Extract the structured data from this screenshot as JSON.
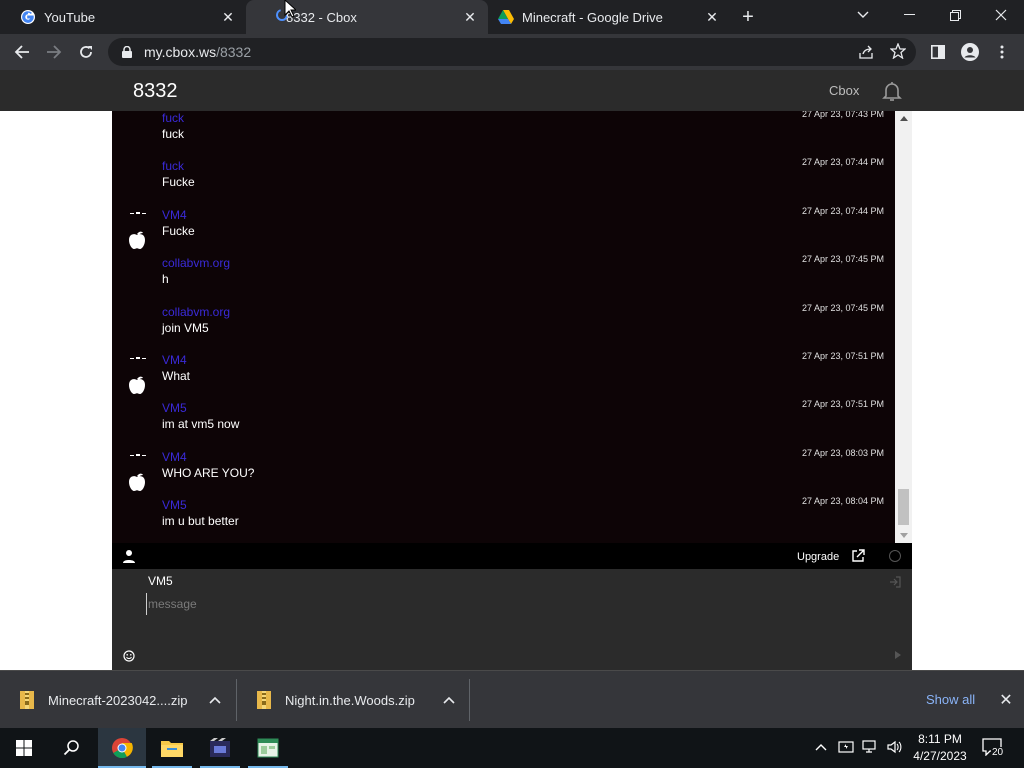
{
  "browser": {
    "tabs": [
      {
        "title": "YouTube",
        "icon": "google-icon",
        "active": false
      },
      {
        "title": "8332 - Cbox",
        "icon": "loading-spinner-icon",
        "active": true
      },
      {
        "title": "Minecraft - Google Drive",
        "icon": "google-drive-icon",
        "active": false
      }
    ],
    "url_host": "my.cbox.ws",
    "url_path": "/8332"
  },
  "site": {
    "box_name": "8332",
    "brand": "Cbox"
  },
  "messages": [
    {
      "name": "fuck",
      "text": "fuck",
      "time": "27 Apr 23, 07:43 PM",
      "avatar": false
    },
    {
      "name": "fuck",
      "text": "Fucke",
      "time": "27 Apr 23, 07:44 PM",
      "avatar": false
    },
    {
      "name": "VM4",
      "text": "Fucke",
      "time": "27 Apr 23, 07:44 PM",
      "avatar": true
    },
    {
      "name": "collabvm.org",
      "text": "h",
      "time": "27 Apr 23, 07:45 PM",
      "avatar": false
    },
    {
      "name": "collabvm.org",
      "text": "join VM5",
      "time": "27 Apr 23, 07:45 PM",
      "avatar": false
    },
    {
      "name": "VM4",
      "text": "What",
      "time": "27 Apr 23, 07:51 PM",
      "avatar": true
    },
    {
      "name": "VM5",
      "text": "im at vm5 now",
      "time": "27 Apr 23, 07:51 PM",
      "avatar": false
    },
    {
      "name": "VM4",
      "text": "WHO ARE YOU?",
      "time": "27 Apr 23, 08:03 PM",
      "avatar": true
    },
    {
      "name": "VM5",
      "text": "im u but better",
      "time": "27 Apr 23, 08:04 PM",
      "avatar": false
    }
  ],
  "statusbar": {
    "upgrade_label": "Upgrade"
  },
  "compose": {
    "username": "VM5",
    "placeholder": "message",
    "value": ""
  },
  "downloads": {
    "items": [
      {
        "filename": "Minecraft-2023042....zip"
      },
      {
        "filename": "Night.in.the.Woods.zip"
      }
    ],
    "show_all": "Show all"
  },
  "taskbar": {
    "time": "8:11 PM",
    "date": "4/27/2023",
    "notification_count": "20"
  },
  "colors": {
    "chat_bg": "#0d0406",
    "username": "#3a2ad8",
    "accent_link": "#8ab4f8"
  }
}
